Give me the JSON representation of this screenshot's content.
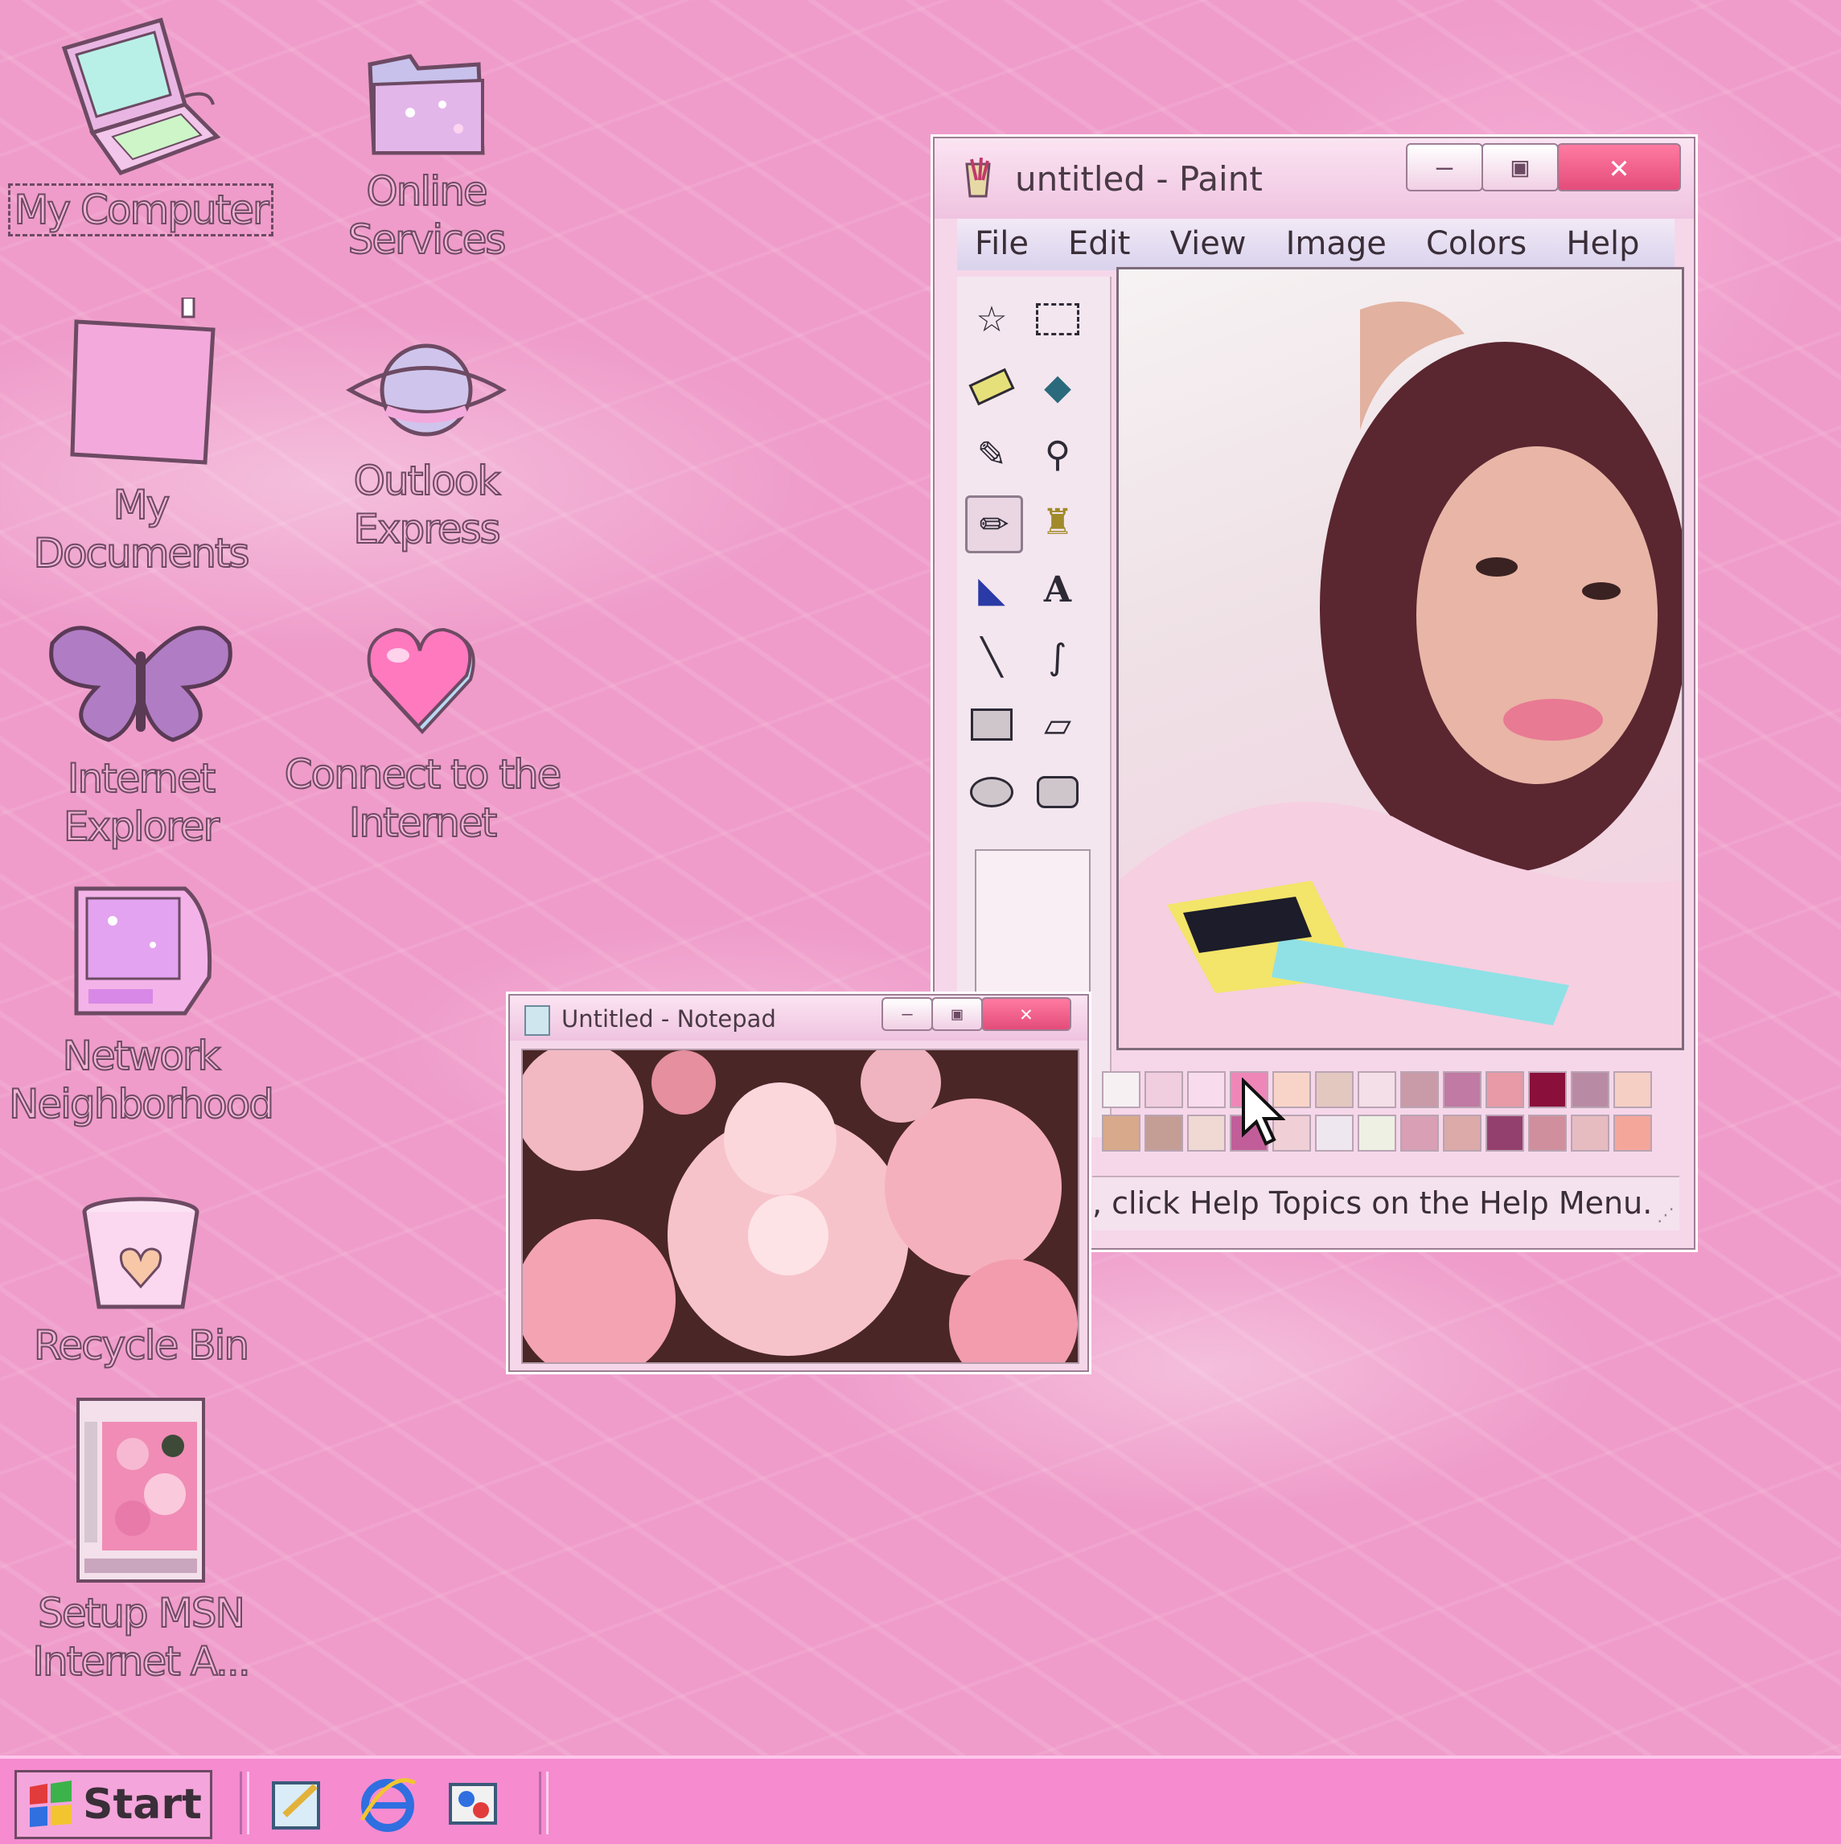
{
  "desktop": {
    "icons": [
      {
        "label": "My Computer",
        "icon": "laptop-icon"
      },
      {
        "label": "Online\nServices",
        "icon": "folder-icon"
      },
      {
        "label": "My Documents",
        "icon": "document-icon"
      },
      {
        "label": "Outlook\nExpress",
        "icon": "saturn-icon"
      },
      {
        "label": "Internet\nExplorer",
        "icon": "butterfly-icon"
      },
      {
        "label": "Connect to the\nInternet",
        "icon": "heart-icon"
      },
      {
        "label": "Network\nNeighborhood",
        "icon": "monitor-icon"
      },
      {
        "label": "Recycle Bin",
        "icon": "recycle-bin-icon"
      },
      {
        "label": "Setup MSN\nInternet A...",
        "icon": "setup-thumbnail-icon"
      }
    ]
  },
  "paint": {
    "title": "untitled - Paint",
    "menu": [
      "File",
      "Edit",
      "View",
      "Image",
      "Colors",
      "Help"
    ],
    "status": ", click Help Topics on the Help Menu.",
    "palette_row1": [
      "#f6f0f3",
      "#f1cde0",
      "#f8dcee",
      "#ef86b8",
      "#f8d4c8",
      "#e3c8c0",
      "#f4dfe8",
      "#c99aa8",
      "#c07aa3",
      "#e89aa6",
      "#8a0f3a",
      "#b98aa4",
      "#f6cfc4"
    ],
    "palette_row2": [
      "#d8a98a",
      "#c49d95",
      "#f0d8d3",
      "#c15e99",
      "#f0cfd6",
      "#efe7f0",
      "#eef0e4",
      "#d99fb4",
      "#dcaaa8",
      "#93406e",
      "#cf8f9c",
      "#e6bcc1",
      "#f5a69a"
    ]
  },
  "notepad": {
    "title": "Untitled - Notepad"
  },
  "taskbar": {
    "start_label": "Start"
  },
  "colors": {
    "desktop": "#ef9cca",
    "taskbar": "#f68bd0",
    "close_button": "#e44c7a"
  }
}
